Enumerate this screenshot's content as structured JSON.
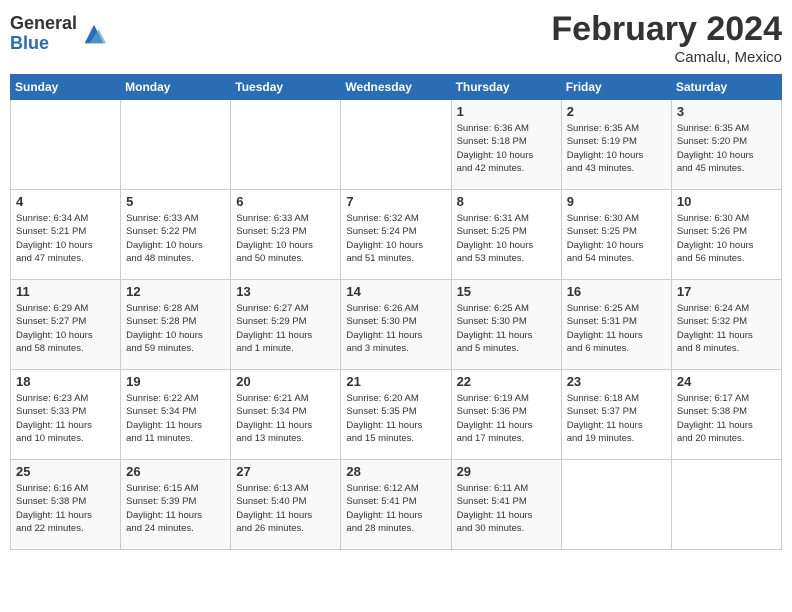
{
  "header": {
    "logo_general": "General",
    "logo_blue": "Blue",
    "month_year": "February 2024",
    "location": "Camalu, Mexico"
  },
  "days_of_week": [
    "Sunday",
    "Monday",
    "Tuesday",
    "Wednesday",
    "Thursday",
    "Friday",
    "Saturday"
  ],
  "weeks": [
    [
      {
        "day": "",
        "info": ""
      },
      {
        "day": "",
        "info": ""
      },
      {
        "day": "",
        "info": ""
      },
      {
        "day": "",
        "info": ""
      },
      {
        "day": "1",
        "info": "Sunrise: 6:36 AM\nSunset: 5:18 PM\nDaylight: 10 hours\nand 42 minutes."
      },
      {
        "day": "2",
        "info": "Sunrise: 6:35 AM\nSunset: 5:19 PM\nDaylight: 10 hours\nand 43 minutes."
      },
      {
        "day": "3",
        "info": "Sunrise: 6:35 AM\nSunset: 5:20 PM\nDaylight: 10 hours\nand 45 minutes."
      }
    ],
    [
      {
        "day": "4",
        "info": "Sunrise: 6:34 AM\nSunset: 5:21 PM\nDaylight: 10 hours\nand 47 minutes."
      },
      {
        "day": "5",
        "info": "Sunrise: 6:33 AM\nSunset: 5:22 PM\nDaylight: 10 hours\nand 48 minutes."
      },
      {
        "day": "6",
        "info": "Sunrise: 6:33 AM\nSunset: 5:23 PM\nDaylight: 10 hours\nand 50 minutes."
      },
      {
        "day": "7",
        "info": "Sunrise: 6:32 AM\nSunset: 5:24 PM\nDaylight: 10 hours\nand 51 minutes."
      },
      {
        "day": "8",
        "info": "Sunrise: 6:31 AM\nSunset: 5:25 PM\nDaylight: 10 hours\nand 53 minutes."
      },
      {
        "day": "9",
        "info": "Sunrise: 6:30 AM\nSunset: 5:25 PM\nDaylight: 10 hours\nand 54 minutes."
      },
      {
        "day": "10",
        "info": "Sunrise: 6:30 AM\nSunset: 5:26 PM\nDaylight: 10 hours\nand 56 minutes."
      }
    ],
    [
      {
        "day": "11",
        "info": "Sunrise: 6:29 AM\nSunset: 5:27 PM\nDaylight: 10 hours\nand 58 minutes."
      },
      {
        "day": "12",
        "info": "Sunrise: 6:28 AM\nSunset: 5:28 PM\nDaylight: 10 hours\nand 59 minutes."
      },
      {
        "day": "13",
        "info": "Sunrise: 6:27 AM\nSunset: 5:29 PM\nDaylight: 11 hours\nand 1 minute."
      },
      {
        "day": "14",
        "info": "Sunrise: 6:26 AM\nSunset: 5:30 PM\nDaylight: 11 hours\nand 3 minutes."
      },
      {
        "day": "15",
        "info": "Sunrise: 6:25 AM\nSunset: 5:30 PM\nDaylight: 11 hours\nand 5 minutes."
      },
      {
        "day": "16",
        "info": "Sunrise: 6:25 AM\nSunset: 5:31 PM\nDaylight: 11 hours\nand 6 minutes."
      },
      {
        "day": "17",
        "info": "Sunrise: 6:24 AM\nSunset: 5:32 PM\nDaylight: 11 hours\nand 8 minutes."
      }
    ],
    [
      {
        "day": "18",
        "info": "Sunrise: 6:23 AM\nSunset: 5:33 PM\nDaylight: 11 hours\nand 10 minutes."
      },
      {
        "day": "19",
        "info": "Sunrise: 6:22 AM\nSunset: 5:34 PM\nDaylight: 11 hours\nand 11 minutes."
      },
      {
        "day": "20",
        "info": "Sunrise: 6:21 AM\nSunset: 5:34 PM\nDaylight: 11 hours\nand 13 minutes."
      },
      {
        "day": "21",
        "info": "Sunrise: 6:20 AM\nSunset: 5:35 PM\nDaylight: 11 hours\nand 15 minutes."
      },
      {
        "day": "22",
        "info": "Sunrise: 6:19 AM\nSunset: 5:36 PM\nDaylight: 11 hours\nand 17 minutes."
      },
      {
        "day": "23",
        "info": "Sunrise: 6:18 AM\nSunset: 5:37 PM\nDaylight: 11 hours\nand 19 minutes."
      },
      {
        "day": "24",
        "info": "Sunrise: 6:17 AM\nSunset: 5:38 PM\nDaylight: 11 hours\nand 20 minutes."
      }
    ],
    [
      {
        "day": "25",
        "info": "Sunrise: 6:16 AM\nSunset: 5:38 PM\nDaylight: 11 hours\nand 22 minutes."
      },
      {
        "day": "26",
        "info": "Sunrise: 6:15 AM\nSunset: 5:39 PM\nDaylight: 11 hours\nand 24 minutes."
      },
      {
        "day": "27",
        "info": "Sunrise: 6:13 AM\nSunset: 5:40 PM\nDaylight: 11 hours\nand 26 minutes."
      },
      {
        "day": "28",
        "info": "Sunrise: 6:12 AM\nSunset: 5:41 PM\nDaylight: 11 hours\nand 28 minutes."
      },
      {
        "day": "29",
        "info": "Sunrise: 6:11 AM\nSunset: 5:41 PM\nDaylight: 11 hours\nand 30 minutes."
      },
      {
        "day": "",
        "info": ""
      },
      {
        "day": "",
        "info": ""
      }
    ]
  ]
}
